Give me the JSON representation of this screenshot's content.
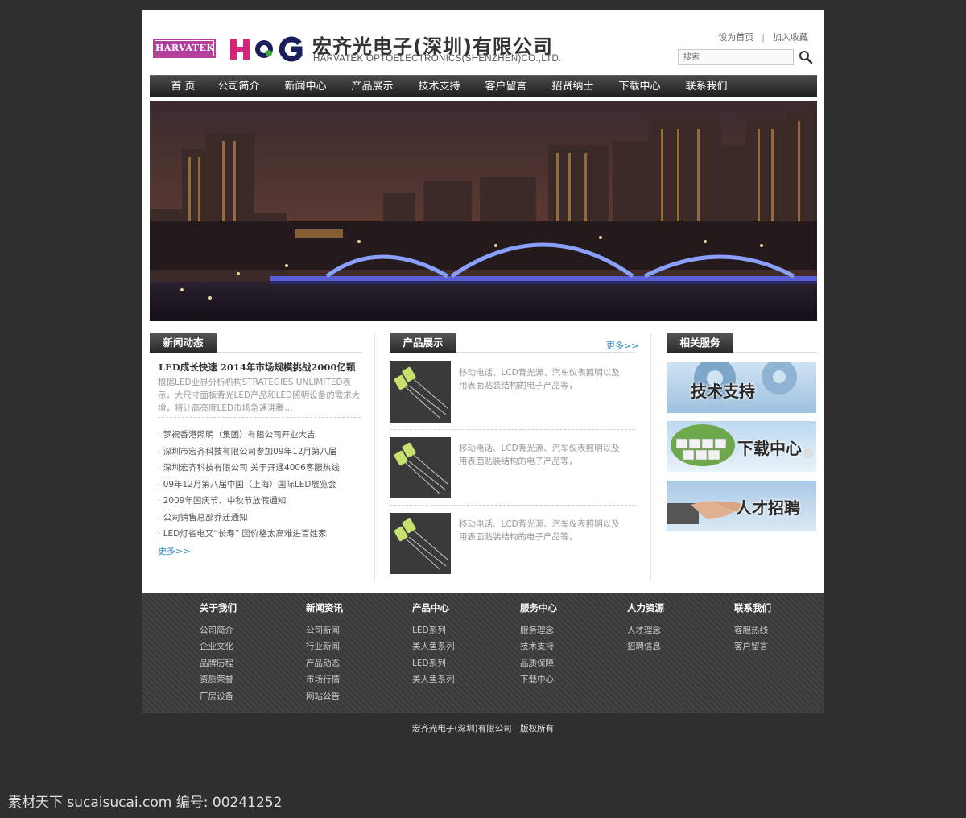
{
  "header": {
    "brand_badge": "HARVATEK",
    "logo_text": "HQG",
    "company_cn": "宏齐光电子(深圳)有限公司",
    "company_en": "HARVATEK OPTOELECTRONICS(SHENZHEN)CO.,LTD.",
    "links": {
      "set_home": "设为首页",
      "separator": "|",
      "bookmark": "加入收藏"
    },
    "search_placeholder": "搜索"
  },
  "nav": [
    "首 页",
    "公司简介",
    "新闻中心",
    "产品展示",
    "技术支持",
    "客户留言",
    "招贤纳士",
    "下载中心",
    "联系我们"
  ],
  "news": {
    "title": "新闻动态",
    "headline": "LED成长快速 2014年市场规模挑战2000亿颗",
    "summary": "根据LED业界分析机构STRATEGIES UNLIMITED表示，大尺寸面板背光LED产品和LED照明设备的需求大增，将让高亮度LED市场急速沸腾…",
    "items": [
      "梦祝香港照明（集团）有限公司开业大吉",
      "深圳市宏齐科技有限公司参加09年12月第八届",
      "深圳宏齐科技有限公司 关于开通4006客服热线",
      "09年12月第八届中国（上海）国际LED展览会",
      "2009年国庆节、中秋节放假通知",
      "公司销售总部乔迁通知",
      "LED灯省电又“长寿” 因价格太高难进百姓家"
    ],
    "more": "更多>>"
  },
  "products": {
    "title": "产品展示",
    "more": "更多>>",
    "items": [
      {
        "desc": "移动电话、LCD背光源、汽车仪表照明以及用表面贴装结构的电子产品等，"
      },
      {
        "desc": "移动电话、LCD背光源、汽车仪表照明以及用表面贴装结构的电子产品等，"
      },
      {
        "desc": "移动电话、LCD背光源、汽车仪表照明以及用表面贴装结构的电子产品等，"
      }
    ]
  },
  "services": {
    "title": "相关服务",
    "items": [
      "技术支持",
      "下载中心",
      "人才招聘"
    ]
  },
  "footer": {
    "columns": [
      {
        "title": "关于我们",
        "items": [
          "公司简介",
          "企业文化",
          "品牌历程",
          "资质荣誉",
          "厂房设备"
        ]
      },
      {
        "title": "新闻资讯",
        "items": [
          "公司新闻",
          "行业新闻",
          "产品动态",
          "市场行情",
          "网站公告"
        ]
      },
      {
        "title": "产品中心",
        "items": [
          "LED系列",
          "美人鱼系列",
          "LED系列",
          "美人鱼系列"
        ]
      },
      {
        "title": "服务中心",
        "items": [
          "服务理念",
          "技术支持",
          "品质保障",
          "下载中心"
        ]
      },
      {
        "title": "人力资源",
        "items": [
          "人才理念",
          "招聘信息"
        ]
      },
      {
        "title": "联系我们",
        "items": [
          "客服热线",
          "客户留言"
        ]
      }
    ],
    "copyright": "宏齐光电子(深圳)有限公司　版权所有"
  },
  "watermark": "素材天下 sucaisucai.com  编号: 00241252",
  "colors": {
    "page_bg": "#2f2f2f",
    "nav_bg": "#2a2a2a",
    "accent_link": "#2a8fc5",
    "badge": "#b43f9d"
  }
}
